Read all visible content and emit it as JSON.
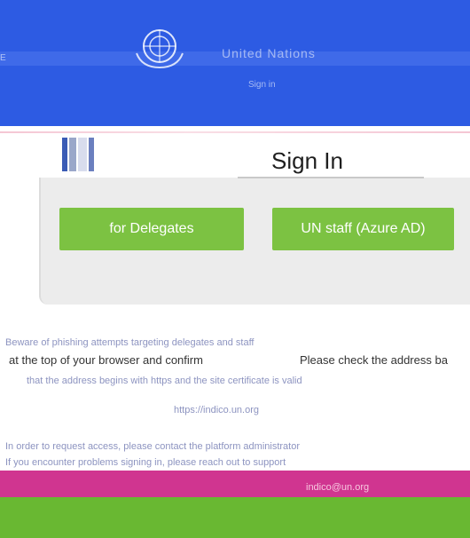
{
  "header": {
    "title": "United Nations",
    "subtitle": "Sign in",
    "left_stub": "E"
  },
  "signin": {
    "title": "Sign In"
  },
  "buttons": {
    "delegates_label": "for Delegates",
    "staff_label": "UN staff (Azure AD)"
  },
  "notice": {
    "line1": "Beware of phishing attempts targeting delegates and staff",
    "line2": "at the top of your browser and confirm",
    "line2_right": "Please check the address ba",
    "line3": "that the address begins with https and the site certificate is valid",
    "line4": "https://indico.un.org",
    "line5": "In order to request access, please contact the platform administrator",
    "line6": "If you encounter problems signing in, please reach out to support",
    "email": "indico@un.org"
  },
  "colors": {
    "header_blue": "#2d5be3",
    "button_green": "#7cc242",
    "footer_magenta": "#c8127c",
    "footer_green": "#69b832"
  }
}
